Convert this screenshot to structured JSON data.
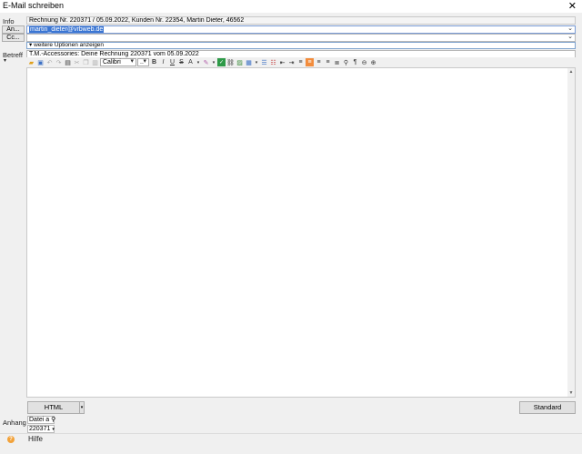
{
  "window": {
    "title": "E-Mail schreiben",
    "close_glyph": "✕"
  },
  "info": {
    "label": "Info",
    "value": "Rechnung Nr. 220371 / 05.09.2022, Kunden Nr. 22354, Martin Dieter, 46562"
  },
  "recipients": {
    "to_button": "An...",
    "to_value": "martin_dieter@vrbweb.de",
    "cc_button": "Cc...",
    "cc_value": "",
    "more_label": "▾ weitere Uptionen anzeigen"
  },
  "subject": {
    "label": "Betreff",
    "arrow": "▾",
    "value": "T.M.-Accessories: Deine Rechnung 220371 vom 05.09.2022"
  },
  "toolbar": {
    "font_name": "Calibri",
    "font_size": "..",
    "bold": "B",
    "italic": "I",
    "underline": "U",
    "strike": "S",
    "font_color": "A",
    "pilcrow": "¶"
  },
  "footer": {
    "format_button": "HTML",
    "format_arrow": "▾",
    "standard_button": "Standard",
    "attachment_label": "Anhang",
    "attach_file_button": "Datei a",
    "attachment_file": "220371",
    "help_label": "Hilfe",
    "help_icon": "?"
  }
}
